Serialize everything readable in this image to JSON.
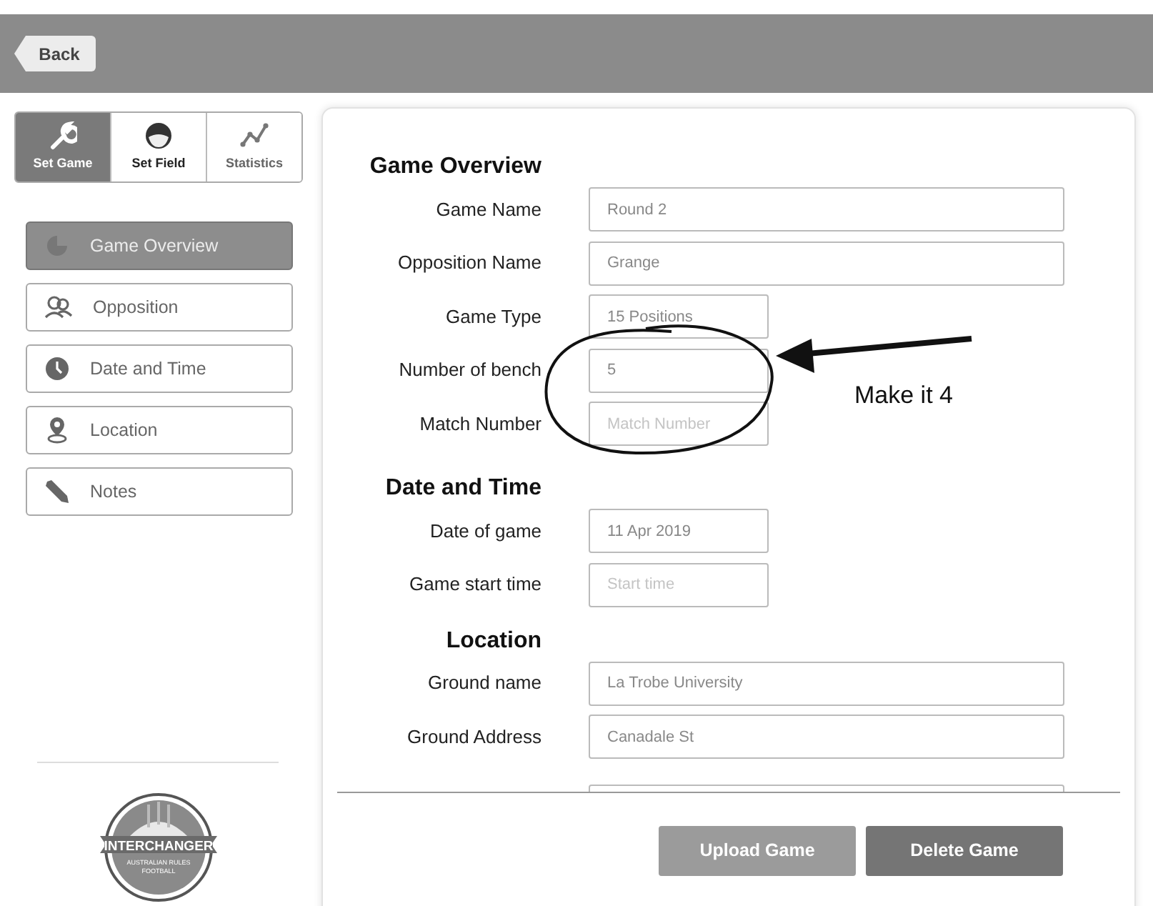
{
  "back_button": "Back",
  "mode_tabs": [
    {
      "label": "Set Game",
      "kind": "wrench",
      "selected": true
    },
    {
      "label": "Set Field",
      "kind": "helmet",
      "selected": false
    },
    {
      "label": "Statistics",
      "kind": "chart",
      "selected": false
    }
  ],
  "nav_items": [
    {
      "label": "Game Overview",
      "kind": "pie",
      "selected": true
    },
    {
      "label": "Opposition",
      "kind": "people",
      "selected": false
    },
    {
      "label": "Date and Time",
      "kind": "clock",
      "selected": false
    },
    {
      "label": "Location",
      "kind": "pin",
      "selected": false
    },
    {
      "label": "Notes",
      "kind": "pencil",
      "selected": false
    }
  ],
  "logo": {
    "title": "INTERCHANGER",
    "subtitle_1": "AUSTRALIAN RULES",
    "subtitle_2": "FOOTBALL"
  },
  "sections": [
    {
      "title": "Game Overview",
      "fields": [
        {
          "label": "Game Name",
          "value": "Round 2",
          "kind": "long"
        },
        {
          "label": "Opposition Name",
          "value": "Grange",
          "kind": "long"
        },
        {
          "label": "Game Type",
          "value": "15 Positions",
          "kind": "short"
        },
        {
          "label": "Number of bench",
          "value": "5",
          "kind": "short"
        },
        {
          "label": "Match Number",
          "placeholder": "Match Number",
          "kind": "short"
        }
      ]
    },
    {
      "title": "Date and Time",
      "fields": [
        {
          "label": "Date of game",
          "value": "11 Apr 2019",
          "kind": "short"
        },
        {
          "label": "Game start time",
          "placeholder": "Start time",
          "kind": "short"
        }
      ]
    },
    {
      "title": "Location",
      "fields": [
        {
          "label": "Ground name",
          "value": "La Trobe University",
          "kind": "long"
        },
        {
          "label": "Ground Address",
          "value": "Canadale St",
          "kind": "long"
        }
      ]
    }
  ],
  "buttons": [
    {
      "label": "Upload Game",
      "kind": "secondary"
    },
    {
      "label": "Delete Game",
      "kind": "primary"
    }
  ],
  "annotation": {
    "note": "Make it 4"
  }
}
